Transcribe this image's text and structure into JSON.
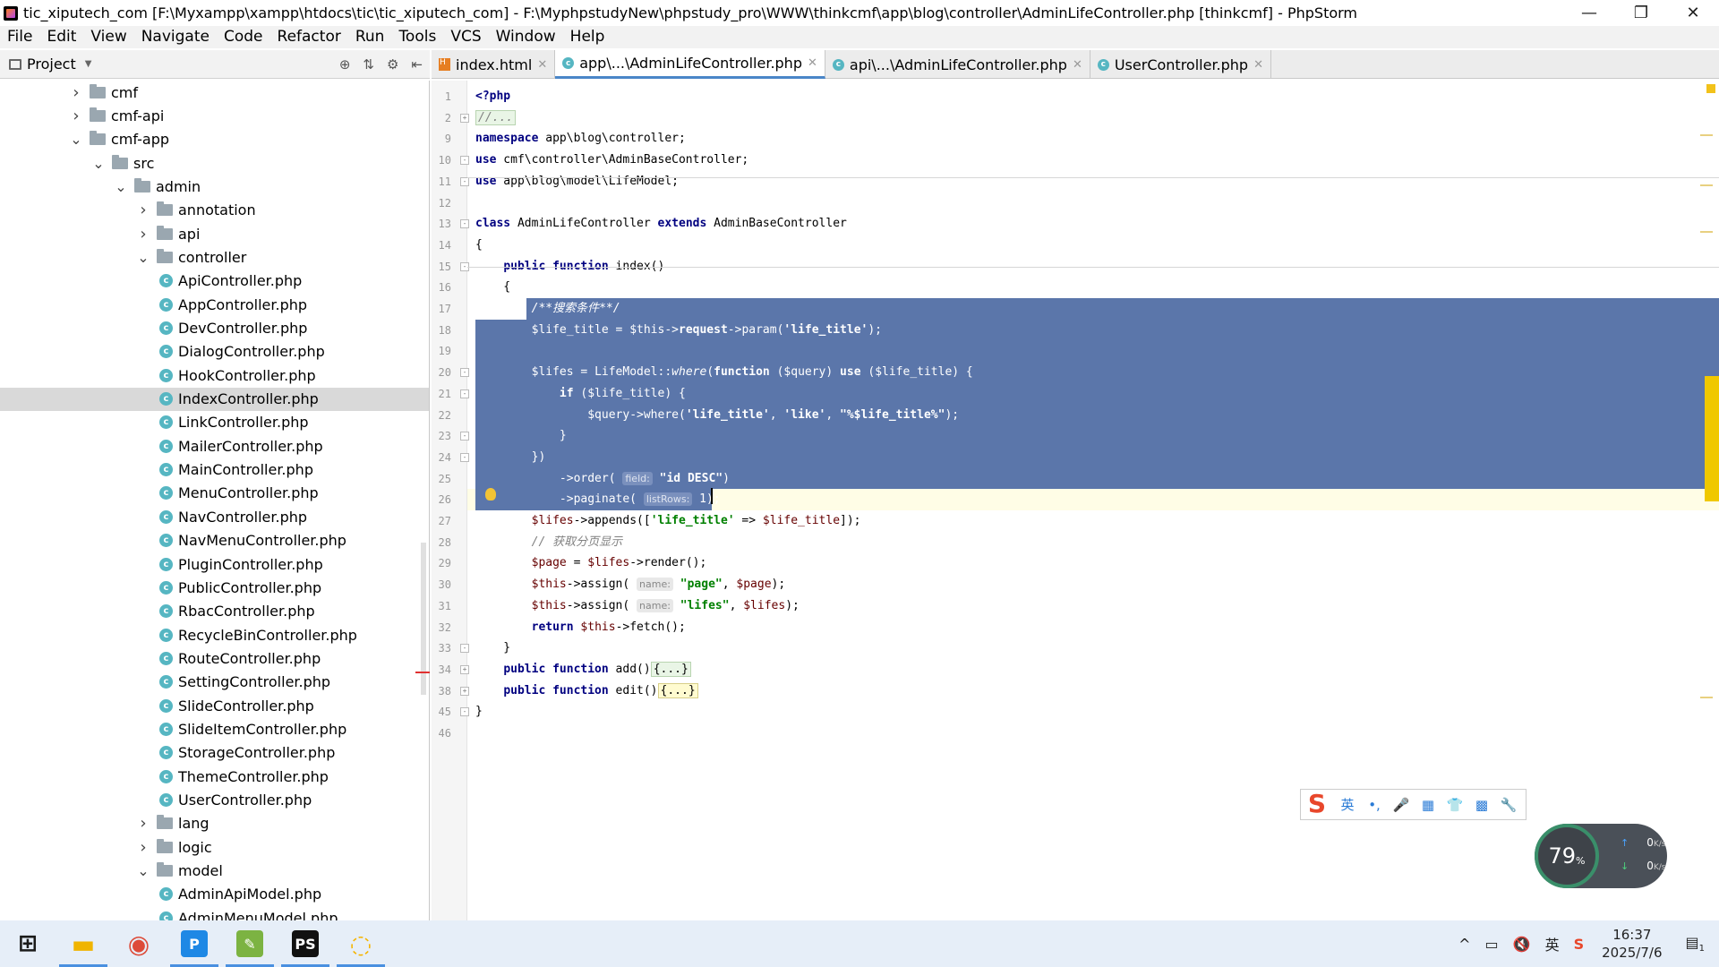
{
  "window": {
    "title": "tic_xiputech_com [F:\\Myxampp\\xampp\\htdocs\\tic\\tic_xiputech_com] - F:\\MyphpstudyNew\\phpstudy_pro\\WWW\\thinkcmf\\app\\blog\\controller\\AdminLifeController.php [thinkcmf] - PhpStorm",
    "minimize": "—",
    "maximize": "❐",
    "close": "✕"
  },
  "menu": [
    "File",
    "Edit",
    "View",
    "Navigate",
    "Code",
    "Refactor",
    "Run",
    "Tools",
    "VCS",
    "Window",
    "Help"
  ],
  "project_panel": {
    "label": "Project",
    "tree": [
      {
        "label": "cmf",
        "type": "folder",
        "depth": 0,
        "expanded": false
      },
      {
        "label": "cmf-api",
        "type": "folder",
        "depth": 0,
        "expanded": false
      },
      {
        "label": "cmf-app",
        "type": "folder",
        "depth": 0,
        "expanded": true
      },
      {
        "label": "src",
        "type": "folder",
        "depth": 1,
        "expanded": true
      },
      {
        "label": "admin",
        "type": "folder",
        "depth": 2,
        "expanded": true
      },
      {
        "label": "annotation",
        "type": "folder",
        "depth": 3,
        "expanded": false
      },
      {
        "label": "api",
        "type": "folder",
        "depth": 3,
        "expanded": false
      },
      {
        "label": "controller",
        "type": "folder",
        "depth": 3,
        "expanded": true
      },
      {
        "label": "ApiController.php",
        "type": "class",
        "depth": 4
      },
      {
        "label": "AppController.php",
        "type": "class",
        "depth": 4
      },
      {
        "label": "DevController.php",
        "type": "class",
        "depth": 4
      },
      {
        "label": "DialogController.php",
        "type": "class",
        "depth": 4
      },
      {
        "label": "HookController.php",
        "type": "class",
        "depth": 4
      },
      {
        "label": "IndexController.php",
        "type": "class",
        "depth": 4,
        "selected": true
      },
      {
        "label": "LinkController.php",
        "type": "class",
        "depth": 4
      },
      {
        "label": "MailerController.php",
        "type": "class",
        "depth": 4
      },
      {
        "label": "MainController.php",
        "type": "class",
        "depth": 4
      },
      {
        "label": "MenuController.php",
        "type": "class",
        "depth": 4
      },
      {
        "label": "NavController.php",
        "type": "class",
        "depth": 4
      },
      {
        "label": "NavMenuController.php",
        "type": "class",
        "depth": 4
      },
      {
        "label": "PluginController.php",
        "type": "class",
        "depth": 4
      },
      {
        "label": "PublicController.php",
        "type": "class",
        "depth": 4
      },
      {
        "label": "RbacController.php",
        "type": "class",
        "depth": 4
      },
      {
        "label": "RecycleBinController.php",
        "type": "class",
        "depth": 4
      },
      {
        "label": "RouteController.php",
        "type": "class",
        "depth": 4
      },
      {
        "label": "SettingController.php",
        "type": "class",
        "depth": 4
      },
      {
        "label": "SlideController.php",
        "type": "class",
        "depth": 4
      },
      {
        "label": "SlideItemController.php",
        "type": "class",
        "depth": 4
      },
      {
        "label": "StorageController.php",
        "type": "class",
        "depth": 4
      },
      {
        "label": "ThemeController.php",
        "type": "class",
        "depth": 4
      },
      {
        "label": "UserController.php",
        "type": "class",
        "depth": 4
      },
      {
        "label": "lang",
        "type": "folder",
        "depth": 3,
        "expanded": false
      },
      {
        "label": "logic",
        "type": "folder",
        "depth": 3,
        "expanded": false
      },
      {
        "label": "model",
        "type": "folder",
        "depth": 3,
        "expanded": true
      },
      {
        "label": "AdminApiModel.php",
        "type": "class",
        "depth": 4
      },
      {
        "label": "AdminMenuModel.php",
        "type": "class",
        "depth": 4
      }
    ]
  },
  "tabs": [
    {
      "label": "index.html",
      "icon": "html-file-icon",
      "active": false
    },
    {
      "label": "app\\...\\AdminLifeController.php",
      "icon": "php-class-icon",
      "active": true
    },
    {
      "label": "api\\...\\AdminLifeController.php",
      "icon": "php-class-icon",
      "active": false
    },
    {
      "label": "UserController.php",
      "icon": "php-class-icon",
      "active": false
    }
  ],
  "editor": {
    "lines": [
      {
        "n": "1",
        "html": "<span class='kw'>&lt;?php</span>"
      },
      {
        "n": "2",
        "html": "<span class='cmt foldbox'>//...</span>",
        "fold": "+"
      },
      {
        "n": "9",
        "html": "<span class='kw'>namespace</span> app\\blog\\controller;"
      },
      {
        "n": "10",
        "html": "<span class='kw'>use</span> cmf\\controller\\AdminBaseController;",
        "fold": "-"
      },
      {
        "n": "11",
        "html": "<span class='kw'>use</span> app\\blog\\model\\LifeModel;",
        "fold": "-"
      },
      {
        "n": "12",
        "html": ""
      },
      {
        "n": "13",
        "html": "<span class='kw'>class</span> AdminLifeController <span class='kw'>extends</span> AdminBaseController",
        "fold": "-"
      },
      {
        "n": "14",
        "html": "{"
      },
      {
        "n": "15",
        "html": "    <span class='kw'>public function</span> index()",
        "fold": "-"
      },
      {
        "n": "16",
        "html": "    {"
      },
      {
        "n": "17",
        "html": "        <span class='cmt'>/**搜索条件**/</span>",
        "sel": "partial"
      },
      {
        "n": "18",
        "html": "        <span class='var'>$life_title</span> = <span class='var'>$this</span>-&gt;<b>request</b>-&gt;param(<span class='str'>'life_title'</span>);",
        "sel": "full"
      },
      {
        "n": "19",
        "html": "",
        "sel": "full"
      },
      {
        "n": "20",
        "html": "        <span class='var'>$lifes</span> = LifeModel::<i>where</i>(<span class='kw'>function</span> (<span class='var'>$query</span>) <span class='kw'>use</span> (<span class='var'>$life_title</span>) {",
        "sel": "full",
        "fold": "-"
      },
      {
        "n": "21",
        "html": "            <span class='kw'>if</span> (<span class='var'>$life_title</span>) {",
        "sel": "full",
        "fold": "-"
      },
      {
        "n": "22",
        "html": "                <span class='var'>$query</span>-&gt;where(<span class='str'>'life_title'</span>, <span class='str'>'like'</span>, <span class='str'>\"%$life_title%\"</span>);",
        "sel": "full"
      },
      {
        "n": "23",
        "html": "            }",
        "sel": "full",
        "fold": "-"
      },
      {
        "n": "24",
        "html": "        })",
        "sel": "full",
        "fold": "-"
      },
      {
        "n": "25",
        "html": "            -&gt;order( <span class='hint'>field:</span> <span class='str'>\"id DESC\"</span>)",
        "sel": "full"
      },
      {
        "n": "26",
        "html": "            -&gt;paginate( <span class='hint'>listRows:</span> 1);",
        "sel": "partial-end",
        "current": true
      },
      {
        "n": "27",
        "html": "        <span class='var'>$lifes</span>-&gt;appends([<span class='str'>'life_title'</span> =&gt; <span class='var'>$life_title</span>]);"
      },
      {
        "n": "28",
        "html": "        <span class='cmt'>// 获取分页显示</span>"
      },
      {
        "n": "29",
        "html": "        <span class='var'>$page</span> = <span class='var'>$lifes</span>-&gt;render();"
      },
      {
        "n": "30",
        "html": "        <span class='var'>$this</span>-&gt;assign( <span class='hint'>name:</span> <span class='str'>\"page\"</span>, <span class='var'>$page</span>);"
      },
      {
        "n": "31",
        "html": "        <span class='var'>$this</span>-&gt;assign( <span class='hint'>name:</span> <span class='str'>\"lifes\"</span>, <span class='var'>$lifes</span>);"
      },
      {
        "n": "32",
        "html": "        <span class='kw'>return</span> <span class='var'>$this</span>-&gt;fetch();"
      },
      {
        "n": "33",
        "html": "    }",
        "fold": "-"
      },
      {
        "n": "34",
        "html": "    <span class='kw'>public function</span> add()<span class='foldbox'>{...}</span>",
        "fold": "+"
      },
      {
        "n": "38",
        "html": "    <span class='kw'>public function</span> edit()<span class='foldbox y'>{...}</span>",
        "fold": "+"
      },
      {
        "n": "45",
        "html": "}",
        "fold": "-"
      },
      {
        "n": "46",
        "html": ""
      }
    ]
  },
  "ime_toolbar": {
    "logo": "S",
    "lang": "英",
    "items": [
      "•,",
      "🎤",
      "▦",
      "👕",
      "▩",
      "🔧"
    ]
  },
  "net_meter": {
    "percent": "79",
    "percent_unit": "%",
    "up": "0",
    "down": "0",
    "unit": "K/s"
  },
  "taskbar": {
    "apps": [
      {
        "name": "windows-start",
        "label": "⊞",
        "color": "#1a1a1a",
        "bg": "transparent"
      },
      {
        "name": "file-explorer",
        "label": "▬",
        "color": "#f0b400",
        "bg": "transparent",
        "active": true
      },
      {
        "name": "chrome",
        "label": "◉",
        "color": "#dd4b39",
        "bg": "transparent"
      },
      {
        "name": "phpstudy",
        "label": "P",
        "color": "#fff",
        "bg": "#1e88e5",
        "active": true
      },
      {
        "name": "notepad-plus",
        "label": "✎",
        "color": "#fff",
        "bg": "#7cb342",
        "active": true
      },
      {
        "name": "phpstorm",
        "label": "PS",
        "color": "#fff",
        "bg": "#111",
        "active": true
      },
      {
        "name": "navicat",
        "label": "◌",
        "color": "#f5b400",
        "bg": "transparent",
        "active": true
      }
    ],
    "tray": [
      "^",
      "▭",
      "🔇",
      "英",
      "S"
    ],
    "time": "16:37",
    "date": "2025/7/6",
    "notify_count": "1"
  }
}
